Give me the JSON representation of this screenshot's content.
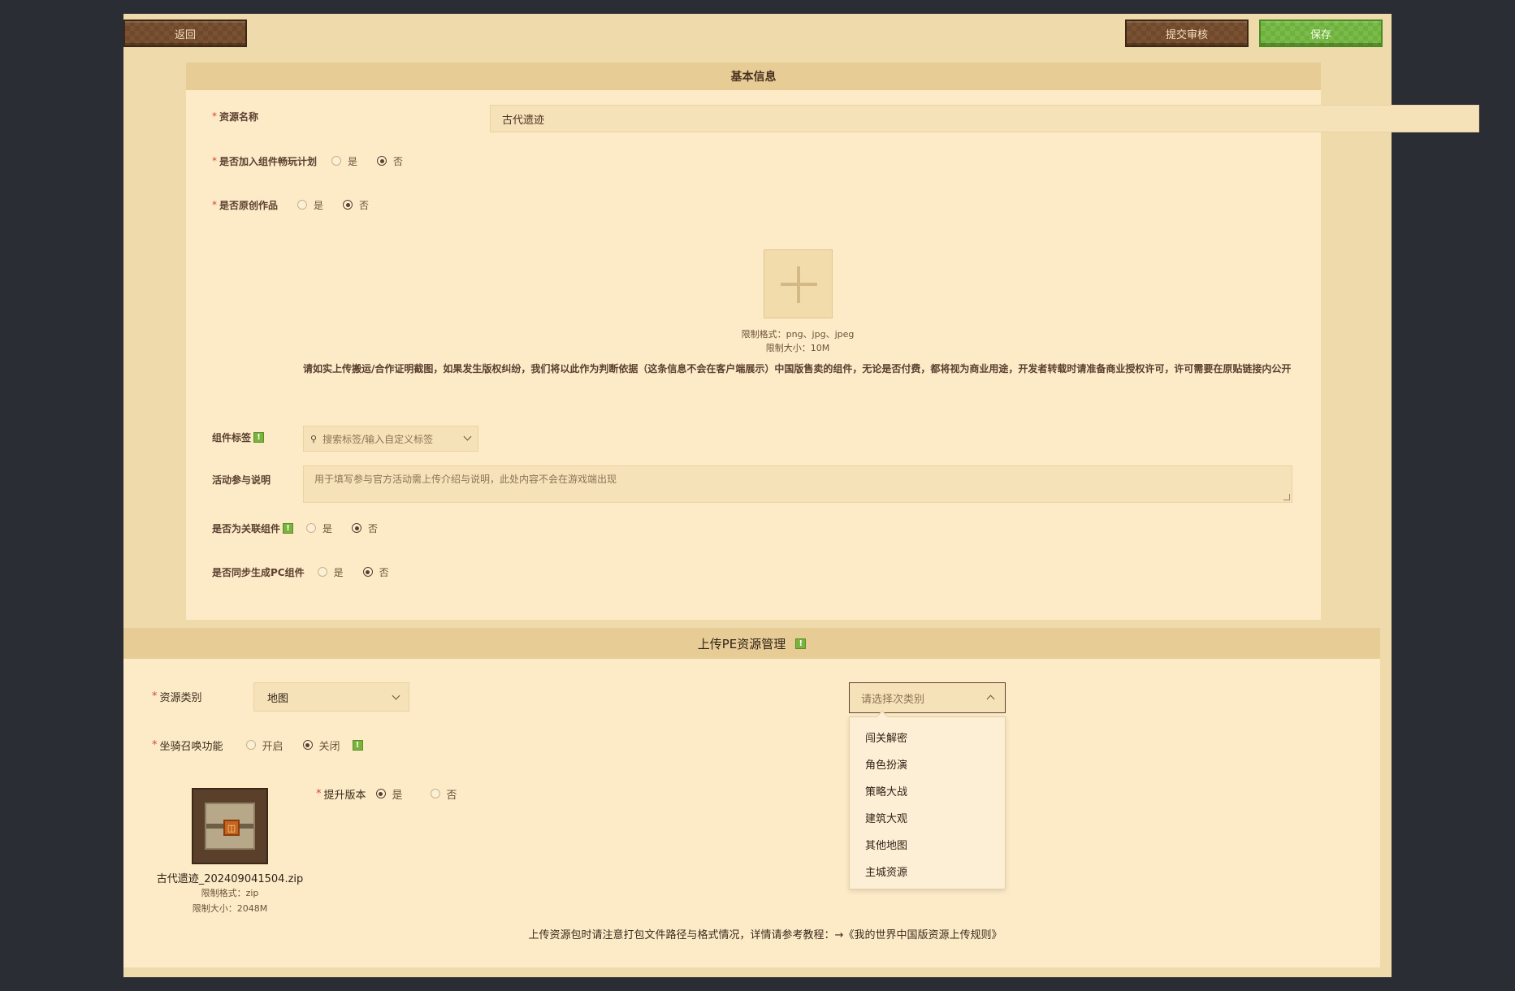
{
  "toolbar": {
    "back_label": "返回",
    "submit_label": "提交审核",
    "save_label": "保存"
  },
  "basic": {
    "title": "基本信息",
    "name_label": "资源名称",
    "name_value": "古代遗迹",
    "plan_label": "是否加入组件畅玩计划",
    "original_label": "是否原创作品",
    "yes": "是",
    "no": "否",
    "upload_formats": "限制格式：png、jpg、jpeg",
    "upload_size": "限制大小：10M",
    "notice": "请如实上传搬运/合作证明截图，如果发生版权纠纷，我们将以此作为判断依据（这条信息不会在客户端展示）中国版售卖的组件，无论是否付费，都将视为商业用途，开发者转载时请准备商业授权许可，许可需要在原贴链接内公开",
    "tags_label": "组件标签",
    "tags_placeholder": "搜索标签/输入自定义标签",
    "activity_label": "活动参与说明",
    "activity_placeholder": "用于填写参与官方活动需上传介绍与说明，此处内容不会在游戏端出现",
    "related_label": "是否为关联组件",
    "pc_label": "是否同步生成PC组件"
  },
  "pe": {
    "title": "上传PE资源管理",
    "category_label": "资源类别",
    "category_value": "地图",
    "subcategory_placeholder": "请选择次类别",
    "subcategory_options": [
      "闯关解密",
      "角色扮演",
      "策略大战",
      "建筑大观",
      "其他地图",
      "主城资源"
    ],
    "mount_label": "坐骑召唤功能",
    "mount_on": "开启",
    "mount_off": "关闭",
    "upgrade_label": "提升版本",
    "upgrade_yes": "是",
    "upgrade_no": "否",
    "file_name": "古代遗迹_202409041504.zip",
    "file_formats": "限制格式：zip",
    "file_size": "限制大小：2048M",
    "footer_note": "上传资源包时请注意打包文件路径与格式情况，详情请参考教程：→《我的世界中国版资源上传规则》"
  },
  "icons": {
    "info": "info-icon",
    "search": "search-icon",
    "chevron_down": "chevron-down-icon",
    "chevron_up": "chevron-up-icon",
    "plus": "plus-icon",
    "zip": "zip-file-icon"
  },
  "colors": {
    "page_bg": "#2a2d34",
    "frame_bg": "#efdaab",
    "panel_bg": "#fdebc8",
    "header_bg": "#e7cc96",
    "brown_button": "#7a5131",
    "green_button": "#6db23a",
    "required": "#d0473a"
  }
}
